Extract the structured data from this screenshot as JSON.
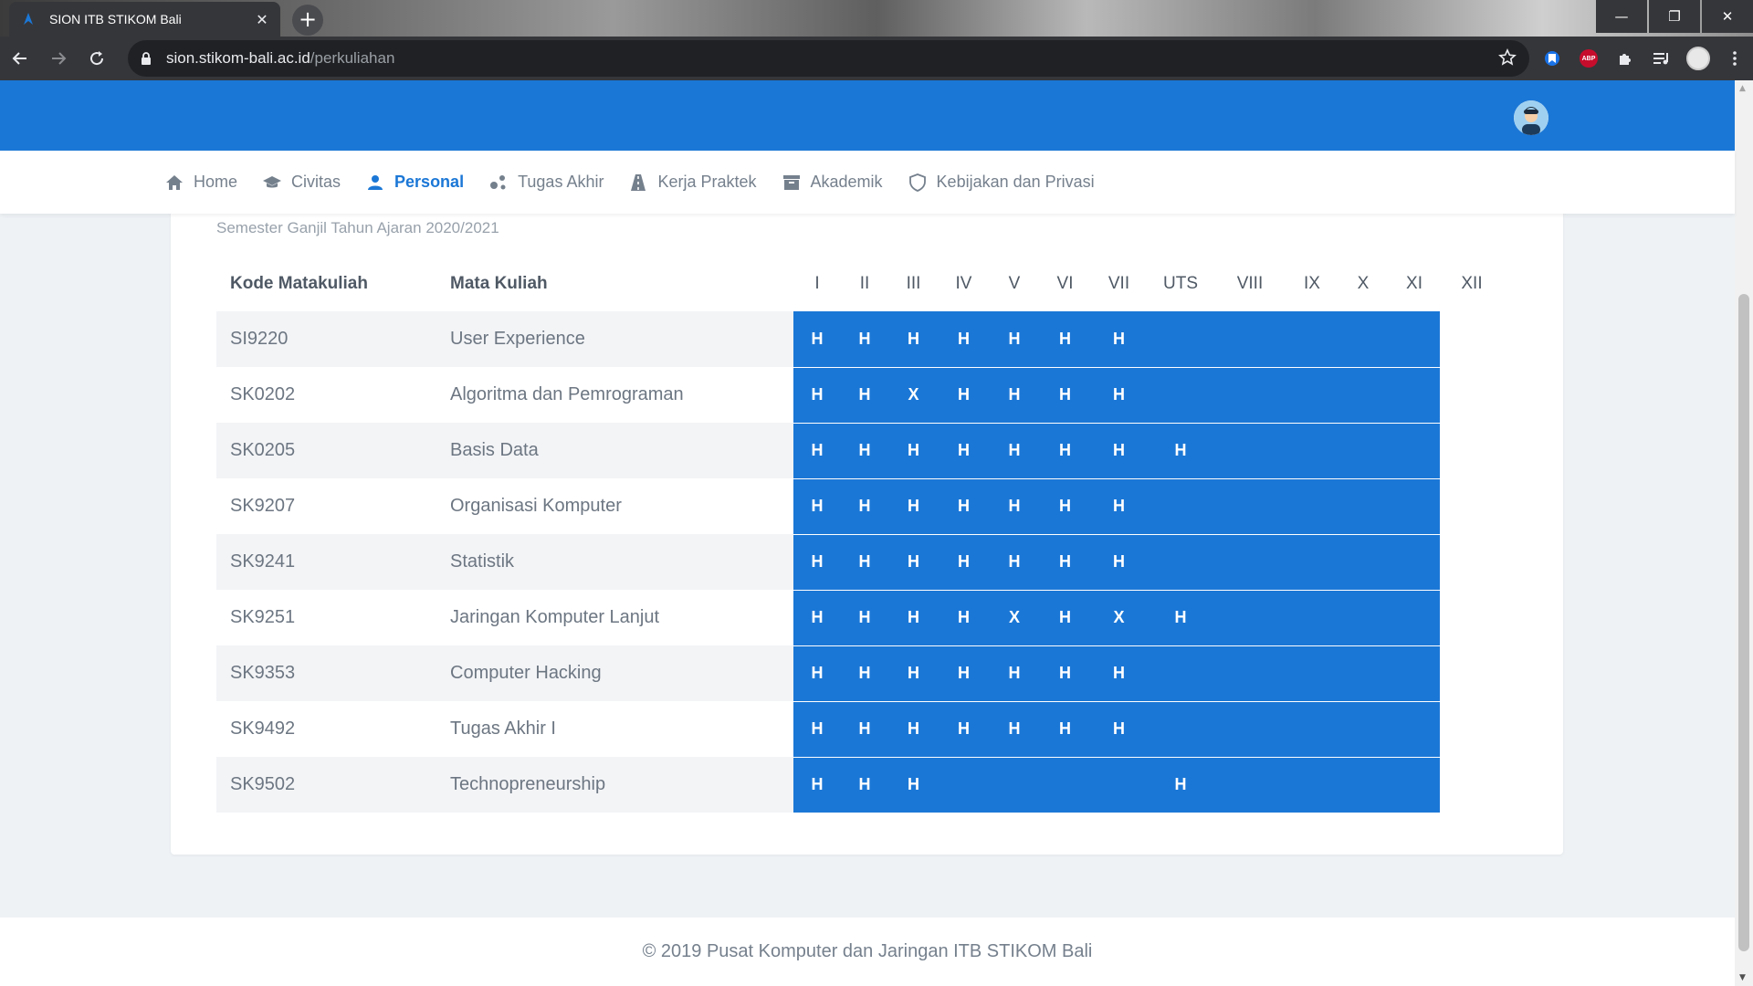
{
  "browser": {
    "tab_title": "SION ITB STIKOM Bali",
    "tab_close": "✕",
    "new_tab": "+",
    "url_host": "sion.stikom-bali.ac.id",
    "url_path": "/perkuliahan",
    "window_controls": {
      "minimize": "—",
      "restore": "❐",
      "close": "✕"
    },
    "extensions": {
      "abp_label": "ABP"
    }
  },
  "nav": {
    "items": [
      {
        "label": "Home",
        "icon": "home-icon"
      },
      {
        "label": "Civitas",
        "icon": "graduation-cap-icon"
      },
      {
        "label": "Personal",
        "icon": "user-icon",
        "active": true
      },
      {
        "label": "Tugas Akhir",
        "icon": "share-nodes-icon"
      },
      {
        "label": "Kerja Praktek",
        "icon": "road-icon"
      },
      {
        "label": "Akademik",
        "icon": "archive-icon"
      },
      {
        "label": "Kebijakan dan Privasi",
        "icon": "shield-icon"
      }
    ]
  },
  "main": {
    "semester": "Semester Ganjil Tahun Ajaran 2020/2021",
    "table": {
      "col_kode": "Kode Matakuliah",
      "col_mata": "Mata Kuliah",
      "meetings": [
        "I",
        "II",
        "III",
        "IV",
        "V",
        "VI",
        "VII",
        "UTS",
        "VIII",
        "IX",
        "X",
        "XI",
        "XII"
      ],
      "rows": [
        {
          "kode": "SI9220",
          "mata": "User Experience",
          "att": [
            "H",
            "H",
            "H",
            "H",
            "H",
            "H",
            "H",
            "",
            "",
            "",
            "",
            "",
            ""
          ]
        },
        {
          "kode": "SK0202",
          "mata": "Algoritma dan Pemrograman",
          "att": [
            "H",
            "H",
            "X",
            "H",
            "H",
            "H",
            "H",
            "",
            "",
            "",
            "",
            "",
            ""
          ]
        },
        {
          "kode": "SK0205",
          "mata": "Basis Data",
          "att": [
            "H",
            "H",
            "H",
            "H",
            "H",
            "H",
            "H",
            "H",
            "",
            "",
            "",
            "",
            ""
          ]
        },
        {
          "kode": "SK9207",
          "mata": "Organisasi Komputer",
          "att": [
            "H",
            "H",
            "H",
            "H",
            "H",
            "H",
            "H",
            "",
            "",
            "",
            "",
            "",
            ""
          ]
        },
        {
          "kode": "SK9241",
          "mata": "Statistik",
          "att": [
            "H",
            "H",
            "H",
            "H",
            "H",
            "H",
            "H",
            "",
            "",
            "",
            "",
            "",
            ""
          ]
        },
        {
          "kode": "SK9251",
          "mata": "Jaringan Komputer Lanjut",
          "att": [
            "H",
            "H",
            "H",
            "H",
            "X",
            "H",
            "X",
            "H",
            "",
            "",
            "",
            "",
            ""
          ]
        },
        {
          "kode": "SK9353",
          "mata": "Computer Hacking",
          "att": [
            "H",
            "H",
            "H",
            "H",
            "H",
            "H",
            "H",
            "",
            "",
            "",
            "",
            "",
            ""
          ]
        },
        {
          "kode": "SK9492",
          "mata": "Tugas Akhir I",
          "att": [
            "H",
            "H",
            "H",
            "H",
            "H",
            "H",
            "H",
            "",
            "",
            "",
            "",
            "",
            ""
          ]
        },
        {
          "kode": "SK9502",
          "mata": "Technopreneurship",
          "att": [
            "H",
            "H",
            "H",
            "",
            "",
            "",
            "",
            "H",
            "",
            "",
            "",
            "",
            ""
          ]
        }
      ]
    }
  },
  "footer": {
    "text": "© 2019 Pusat Komputer dan Jaringan ITB STIKOM Bali"
  },
  "colors": {
    "brand": "#1b77d6",
    "text_muted": "#75808d"
  }
}
